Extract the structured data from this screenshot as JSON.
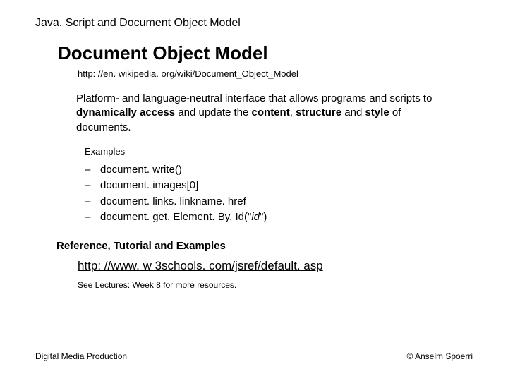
{
  "header": "Java. Script and Document Object Model",
  "title": "Document Object Model",
  "wiki_url": "http: //en. wikipedia. org/wiki/Document_Object_Model",
  "description": {
    "pre1": "Platform- and language-neutral interface that allows programs and scripts to ",
    "bold1": "dynamically access",
    "mid1": " and update the ",
    "bold2": "content",
    "mid2": ", ",
    "bold3": "structure",
    "mid3": " and ",
    "bold4": "style",
    "post": " of documents."
  },
  "examples_label": "Examples",
  "examples": [
    "document. write()",
    "document. images[0]",
    "document. links. linkname. href"
  ],
  "example4_prefix": "document. get. Element. By. Id(\"",
  "example4_arg": "id",
  "example4_suffix": "\")",
  "ref_heading": "Reference, Tutorial and Examples",
  "ref_url": "http: //www. w 3schools. com/jsref/default. asp",
  "see_lectures": "See Lectures: Week 8 for more resources.",
  "footer_left": "Digital Media Production",
  "footer_right": "© Anselm Spoerri"
}
